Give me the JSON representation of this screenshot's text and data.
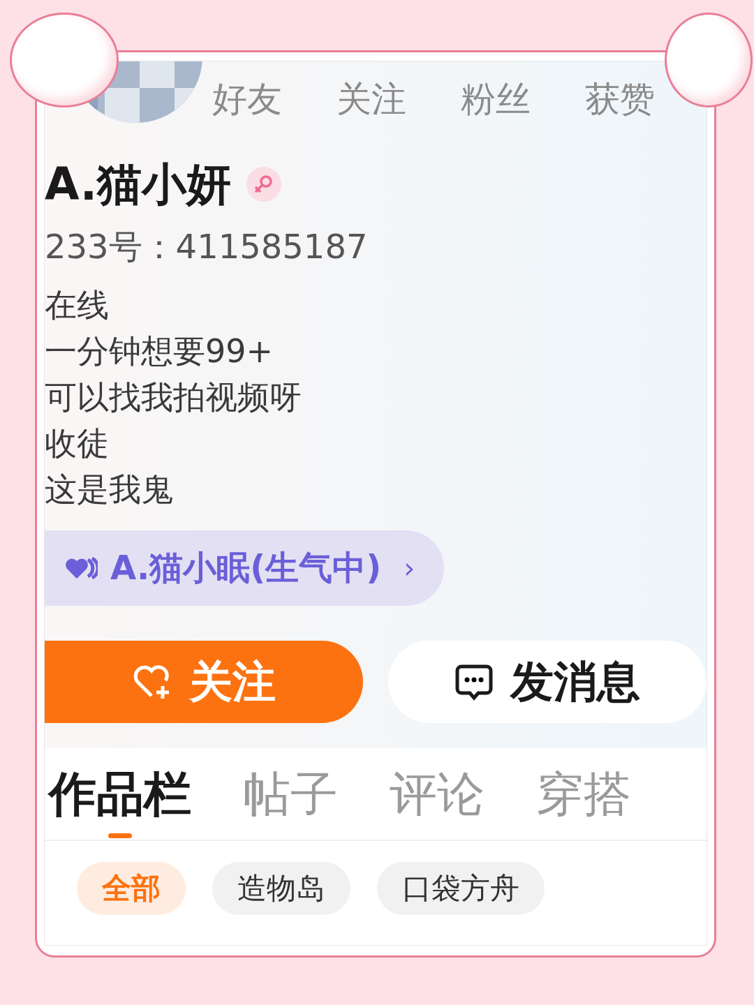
{
  "stats": [
    {
      "label": "好友"
    },
    {
      "label": "关注"
    },
    {
      "label": "粉丝"
    },
    {
      "label": "获赞"
    }
  ],
  "profile": {
    "name": "A.猫小妍",
    "female": true,
    "id": "233号：411585187",
    "bio": [
      "在线",
      "一分钟想要99+",
      "可以找我拍视频呀",
      "收徒",
      "这是我鬼"
    ]
  },
  "linked_user": {
    "name": "A.猫小眠(生气中)",
    "chevron": "›"
  },
  "actions": [
    {
      "label": "关注",
      "kind": "primary"
    },
    {
      "label": "发消息",
      "kind": "secondary"
    }
  ],
  "tabs": [
    {
      "label": "作品栏",
      "selected": true
    },
    {
      "label": "帖子",
      "selected": false
    },
    {
      "label": "评论",
      "selected": false
    },
    {
      "label": "穿搭",
      "selected": false
    }
  ],
  "filters": [
    {
      "label": "全部",
      "selected": true
    },
    {
      "label": "造物岛",
      "selected": false
    },
    {
      "label": "口袋方舟",
      "selected": false
    }
  ]
}
